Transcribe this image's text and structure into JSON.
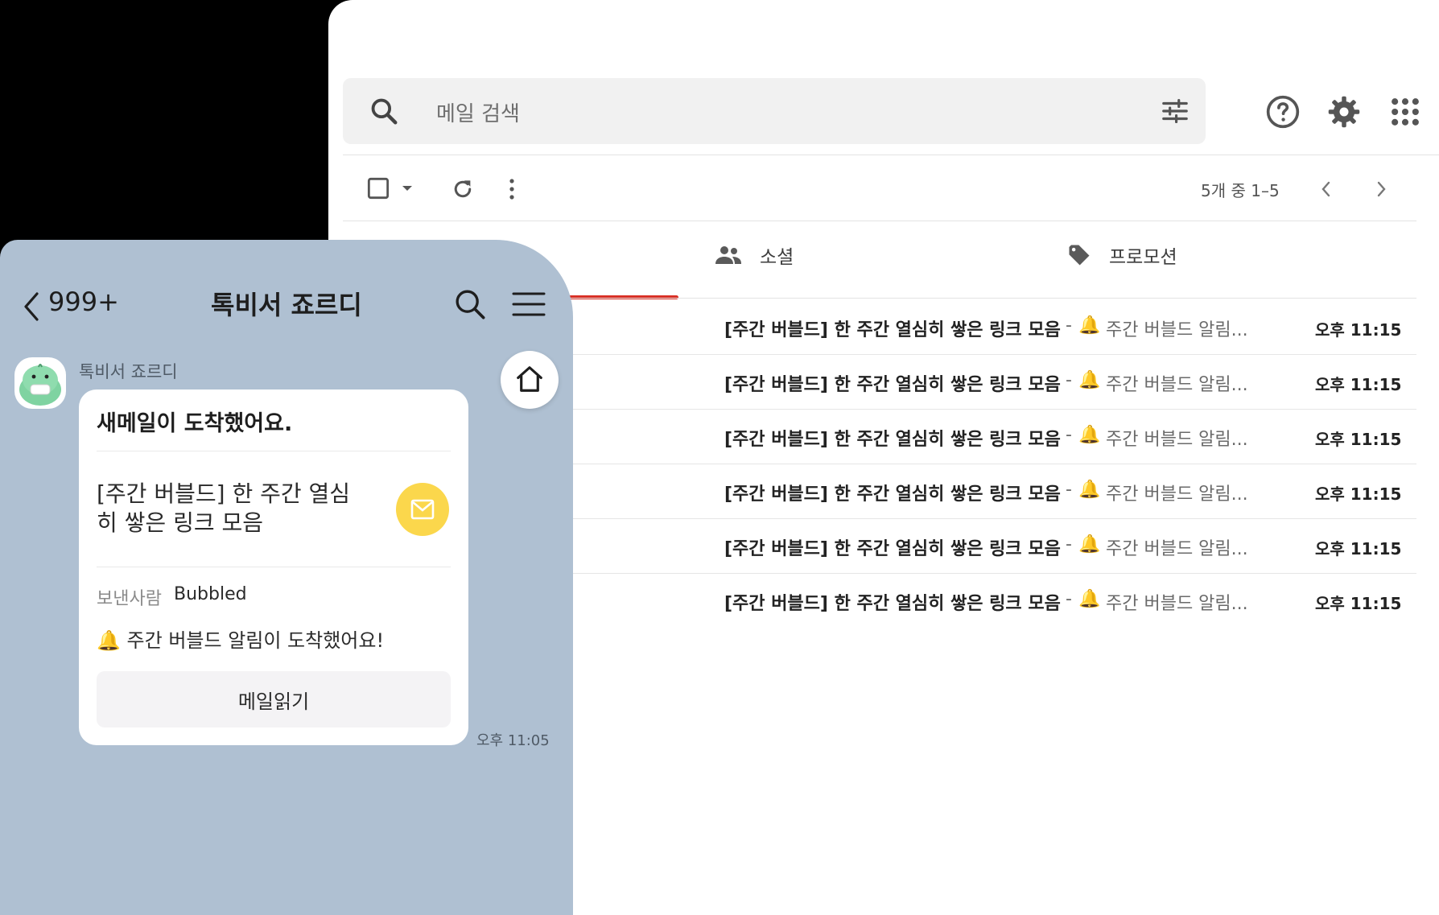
{
  "mail": {
    "search": {
      "placeholder": "메일 검색"
    },
    "pager": "5개 중 1–5",
    "tabs": [
      {
        "label": "소셜",
        "icon": "people-icon"
      },
      {
        "label": "프로모션",
        "icon": "tag-icon"
      }
    ],
    "rows": [
      {
        "subject": "[주간 버블드] 한 주간 열심히 쌓은 링크 모음",
        "separator": "-",
        "bell": "🔔",
        "snippet": "주간 버블드 알림...",
        "time": "오후 11:15"
      },
      {
        "subject": "[주간 버블드] 한 주간 열심히 쌓은 링크 모음",
        "separator": "-",
        "bell": "🔔",
        "snippet": "주간 버블드 알림...",
        "time": "오후 11:15"
      },
      {
        "subject": "[주간 버블드] 한 주간 열심히 쌓은 링크 모음",
        "separator": "-",
        "bell": "🔔",
        "snippet": "주간 버블드 알림...",
        "time": "오후 11:15"
      },
      {
        "subject": "[주간 버블드] 한 주간 열심히 쌓은 링크 모음",
        "separator": "-",
        "bell": "🔔",
        "snippet": "주간 버블드 알림...",
        "time": "오후 11:15"
      },
      {
        "subject": "[주간 버블드] 한 주간 열심히 쌓은 링크 모음",
        "separator": "-",
        "bell": "🔔",
        "snippet": "주간 버블드 알림...",
        "time": "오후 11:15"
      },
      {
        "subject": "[주간 버블드] 한 주간 열심히 쌓은 링크 모음",
        "separator": "-",
        "bell": "🔔",
        "snippet": "주간 버블드 알림...",
        "time": "오후 11:15"
      }
    ],
    "accent": "#d93025"
  },
  "chat": {
    "back_count": "999+",
    "title": "톡비서 죠르디",
    "sender": "톡비서 죠르디",
    "bubble": {
      "title": "새메일이 도착했어요.",
      "subject": "[주간 버블드] 한 주간 열심히 쌓은 링크 모음",
      "from_label": "보낸사람",
      "from_name": "Bubbled",
      "bell": "🔔",
      "notice": "주간 버블드 알림이 도착했어요!",
      "read_button": "메일읽기"
    },
    "timestamp": "오후 11:05",
    "background": "#afc0d2",
    "mail_badge_color": "#fbd74c"
  }
}
